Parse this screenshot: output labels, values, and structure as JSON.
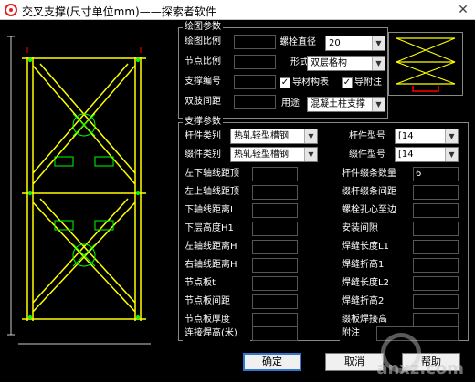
{
  "window": {
    "title": "交叉支撑(尺寸单位mm)——探索者软件",
    "close": "✕"
  },
  "draw_params": {
    "section": "绘图参数",
    "rows": [
      {
        "label": "绘图比例",
        "value": ""
      },
      {
        "label": "节点比例",
        "value": ""
      },
      {
        "label": "支撑编号",
        "value": ""
      },
      {
        "label": "双肢间距",
        "value": ""
      }
    ],
    "bolt_dia": {
      "label": "螺栓直径",
      "value": "20"
    },
    "form": {
      "label": "形式",
      "value": "双层格构"
    },
    "checks": [
      {
        "label": "导材构表",
        "checked": true
      },
      {
        "label": "导附注",
        "checked": true
      }
    ],
    "usage": {
      "label": "用途",
      "value": "混凝土柱支撑"
    }
  },
  "support_params": {
    "section": "支撑参数",
    "combos": [
      {
        "label": "杆件类别",
        "value": "热轧轻型槽钢"
      },
      {
        "label": "缀件类别",
        "value": "热轧轻型槽钢"
      }
    ],
    "right_combos": [
      {
        "label": "杆件型号",
        "value": "[14"
      },
      {
        "label": "缀件型号",
        "value": "[14"
      }
    ],
    "left_rows": [
      {
        "label": "左下轴线距顶",
        "value": ""
      },
      {
        "label": "左上轴线距顶",
        "value": ""
      },
      {
        "label": "下轴线距离L",
        "value": ""
      },
      {
        "label": "下层高度H1",
        "value": ""
      },
      {
        "label": "左轴线距离H",
        "value": ""
      },
      {
        "label": "右轴线距离H",
        "value": ""
      },
      {
        "label": "节点板t",
        "value": ""
      },
      {
        "label": "节点板间距",
        "value": ""
      },
      {
        "label": "节点板厚度",
        "value": ""
      },
      {
        "label": "连接焊高(米)",
        "value": ""
      }
    ],
    "right_rows": [
      {
        "label": "杆件缀条数量",
        "value": "6"
      },
      {
        "label": "缀杆缀条间距",
        "value": ""
      },
      {
        "label": "螺栓孔心至边",
        "value": ""
      },
      {
        "label": "安装间隙",
        "value": ""
      },
      {
        "label": "焊缝长度L1",
        "value": ""
      },
      {
        "label": "焊缝折高1",
        "value": ""
      },
      {
        "label": "焊缝长度L2",
        "value": ""
      },
      {
        "label": "焊缝折高2",
        "value": ""
      },
      {
        "label": "缀板焊接高",
        "value": ""
      },
      {
        "label": "附注",
        "value": ""
      }
    ]
  },
  "buttons": {
    "ok": "确定",
    "cancel": "取消",
    "help": "帮助"
  },
  "watermark": "anxz.com",
  "colors": {
    "structure": "#ffff00",
    "bolts": "#00ff00",
    "text": "#ffffff",
    "dims": "#cccccc",
    "accent": "#ff0000"
  }
}
